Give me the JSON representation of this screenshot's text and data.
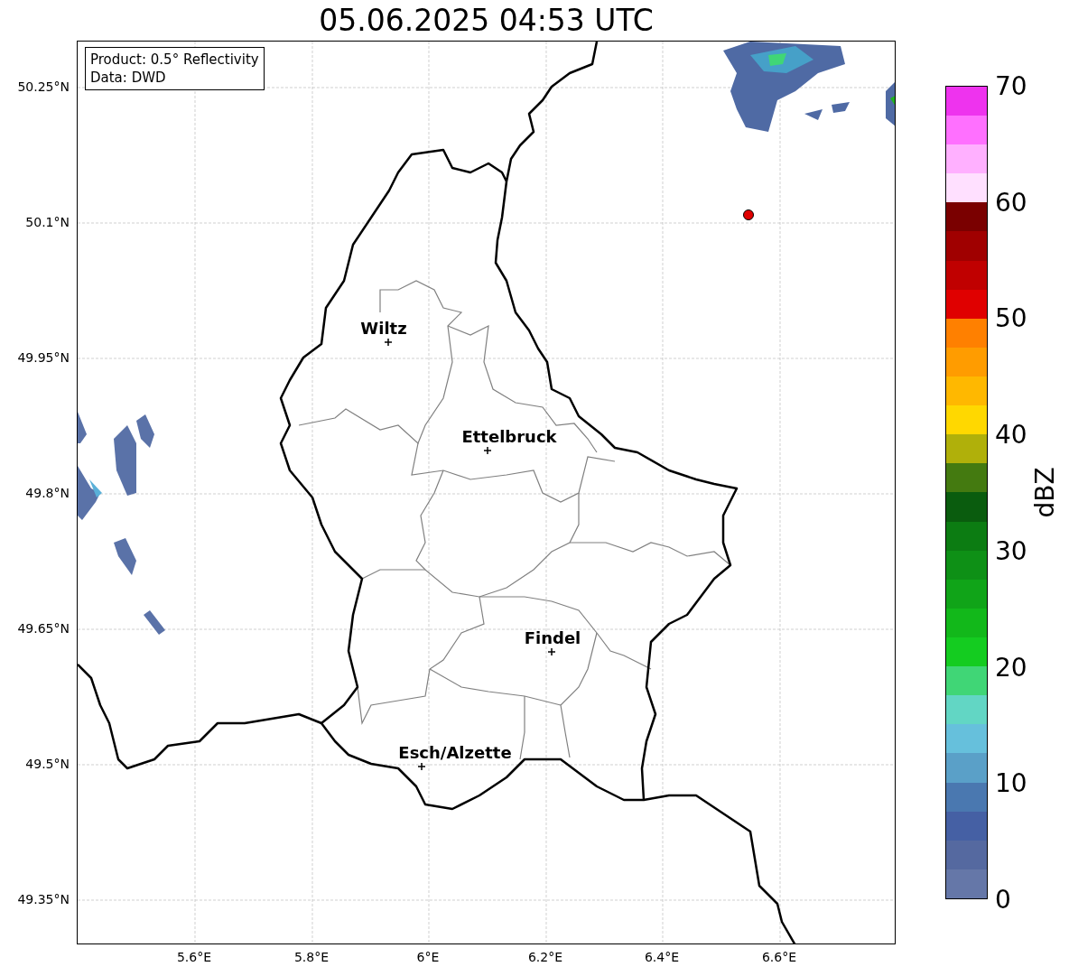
{
  "title": "05.06.2025 04:53 UTC",
  "info_box": {
    "lines": [
      "Product: 0.5° Reflectivity",
      "Data: DWD"
    ]
  },
  "cities": [
    {
      "name": "Wiltz"
    },
    {
      "name": "Ettelbruck"
    },
    {
      "name": "Findel"
    },
    {
      "name": "Esch/Alzette"
    }
  ],
  "y_axis": {
    "ticks": [
      "50.25°N",
      "50.1°N",
      "49.95°N",
      "49.8°N",
      "49.65°N",
      "49.5°N",
      "49.35°N"
    ]
  },
  "x_axis": {
    "ticks": [
      "5.6°E",
      "5.8°E",
      "6°E",
      "6.2°E",
      "6.4°E",
      "6.6°E"
    ]
  },
  "colorbar": {
    "label": "dBZ",
    "ticks": [
      "70",
      "60",
      "50",
      "40",
      "30",
      "20",
      "10",
      "0"
    ],
    "segments": [
      {
        "color": "#6577a8"
      },
      {
        "color": "#5569a0"
      },
      {
        "color": "#4560a4"
      },
      {
        "color": "#4a78b0"
      },
      {
        "color": "#5aa0c8"
      },
      {
        "color": "#66c0dc"
      },
      {
        "color": "#62d6c4"
      },
      {
        "color": "#40d676"
      },
      {
        "color": "#14cc20"
      },
      {
        "color": "#12b81a"
      },
      {
        "color": "#10a418"
      },
      {
        "color": "#0e9016"
      },
      {
        "color": "#0c7c12"
      },
      {
        "color": "#0a5c0e"
      },
      {
        "color": "#447a10"
      },
      {
        "color": "#b0b00a"
      },
      {
        "color": "#ffd800"
      },
      {
        "color": "#ffb800"
      },
      {
        "color": "#ff9c00"
      },
      {
        "color": "#ff8000"
      },
      {
        "color": "#e00000"
      },
      {
        "color": "#c00000"
      },
      {
        "color": "#a00000"
      },
      {
        "color": "#7a0000"
      },
      {
        "color": "#ffe0ff"
      },
      {
        "color": "#ffb0ff"
      },
      {
        "color": "#ff70ff"
      },
      {
        "color": "#ee33ee"
      }
    ]
  }
}
